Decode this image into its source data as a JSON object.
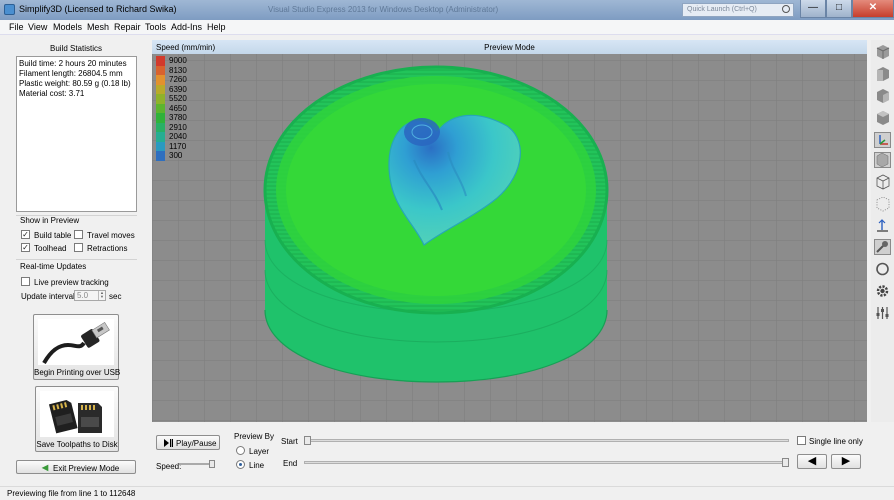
{
  "window": {
    "title": "Simplify3D (Licensed to Richard Swika)",
    "ghost_title": "Visual Studio Express 2013 for Windows Desktop (Administrator)",
    "quick_launch_placeholder": "Quick Launch (Ctrl+Q)",
    "min_glyph": "—",
    "max_glyph": "□",
    "close_glyph": "✕"
  },
  "menu": [
    "File",
    "View",
    "Models",
    "Mesh",
    "Repair",
    "Tools",
    "Add-Ins",
    "Help"
  ],
  "build_statistics": {
    "title": "Build Statistics",
    "lines": [
      "Build time: 2 hours 20 minutes",
      "Filament length: 26804.5 mm",
      "Plastic weight: 80.59 g (0.18 lb)",
      "Material cost: 3.71"
    ]
  },
  "show_in_preview": {
    "title": "Show in Preview",
    "options": [
      {
        "label": "Build table",
        "checked": true
      },
      {
        "label": "Travel moves",
        "checked": false
      },
      {
        "label": "Toolhead",
        "checked": true
      },
      {
        "label": "Retractions",
        "checked": false
      }
    ]
  },
  "realtime": {
    "title": "Real-time Updates",
    "live_label": "Live preview tracking",
    "live_checked": false,
    "interval_label": "Update interval",
    "interval_value": "5.0",
    "interval_unit": "sec"
  },
  "usb_button": {
    "label": "Begin Printing over USB",
    "icon": "usb-cable-icon"
  },
  "sd_button": {
    "label": "Save Toolpaths to Disk",
    "icon": "sd-card-icon"
  },
  "exit_button": {
    "label": "Exit Preview Mode",
    "icon": "back-arrow-icon"
  },
  "viewport": {
    "mode_label": "Preview Mode",
    "legend_title": "Speed (mm/min)",
    "legend": [
      {
        "label": "9000",
        "color": "#d23a2c"
      },
      {
        "label": "8130",
        "color": "#d9622e"
      },
      {
        "label": "7260",
        "color": "#e2912e"
      },
      {
        "label": "6390",
        "color": "#b9aa2a"
      },
      {
        "label": "5520",
        "color": "#8fb22a"
      },
      {
        "label": "4650",
        "color": "#5cb52e"
      },
      {
        "label": "3780",
        "color": "#2fb23a"
      },
      {
        "label": "2910",
        "color": "#28b065"
      },
      {
        "label": "2040",
        "color": "#26ad92"
      },
      {
        "label": "1170",
        "color": "#2a9ac0"
      },
      {
        "label": "300",
        "color": "#2e6fbf"
      }
    ]
  },
  "right_toolbar": [
    "view-cube-icon",
    "view-front-icon",
    "view-side-icon",
    "view-top-icon",
    "axes-icon",
    "solid-cube-icon",
    "wireframe-cube-icon",
    "dotted-cube-icon",
    "move-icon",
    "probe-icon",
    "ring-icon",
    "gear-icon",
    "sliders-icon"
  ],
  "playback": {
    "play_label": "Play/Pause",
    "speed_label": "Speed:",
    "speed_fraction": 0.9,
    "preview_by_label": "Preview By",
    "layer_label": "Layer",
    "line_label": "Line",
    "selected": "Line",
    "start_label": "Start",
    "end_label": "End",
    "start_fraction": 0.0,
    "end_fraction": 1.0,
    "single_line_label": "Single line only",
    "single_line_checked": false,
    "prev_glyph": "◀",
    "next_glyph": "▶"
  },
  "status": "Previewing file from line 1 to 112648"
}
